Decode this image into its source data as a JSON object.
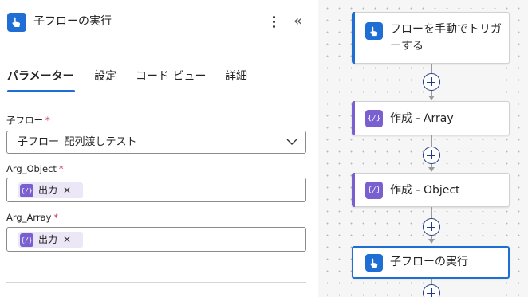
{
  "panel": {
    "title": "子フローの実行",
    "more_icon": "more-vertical-icon",
    "collapse_icon": "chevron-double-left-icon",
    "collapse_glyph": "«",
    "tabs": [
      {
        "label": "パラメーター",
        "active": true
      },
      {
        "label": "設定",
        "active": false
      },
      {
        "label": "コード ビュー",
        "active": false
      },
      {
        "label": "詳細",
        "active": false
      }
    ],
    "fields": {
      "child_flow": {
        "label": "子フロー",
        "required_mark": "*",
        "value": "子フロー_配列渡しテスト"
      },
      "arg_object": {
        "label": "Arg_Object",
        "required_mark": "*",
        "token_label": "出力",
        "token_icon_text": "{/}",
        "remove_glyph": "✕"
      },
      "arg_array": {
        "label": "Arg_Array",
        "required_mark": "*",
        "token_label": "出力",
        "token_icon_text": "{/}",
        "remove_glyph": "✕"
      }
    }
  },
  "canvas": {
    "nodes": [
      {
        "title_line1": "フローを手動でトリガ",
        "title_line2": "ーする",
        "icon": "manual-trigger-icon",
        "accent": "#1f6ed4"
      },
      {
        "title": "作成 - Array",
        "icon": "compose-icon",
        "icon_text": "{/}",
        "accent": "#7a5fd1"
      },
      {
        "title": "作成 - Object",
        "icon": "compose-icon",
        "icon_text": "{/}",
        "accent": "#7a5fd1"
      },
      {
        "title": "子フローの実行",
        "icon": "manual-trigger-icon",
        "accent": "#1f6ed4",
        "selected": true
      }
    ]
  },
  "colors": {
    "accent_blue": "#1f6ed4",
    "compose_purple": "#7a5fd1",
    "token_bg": "#ebe7f6",
    "required_red": "#c4314b"
  }
}
